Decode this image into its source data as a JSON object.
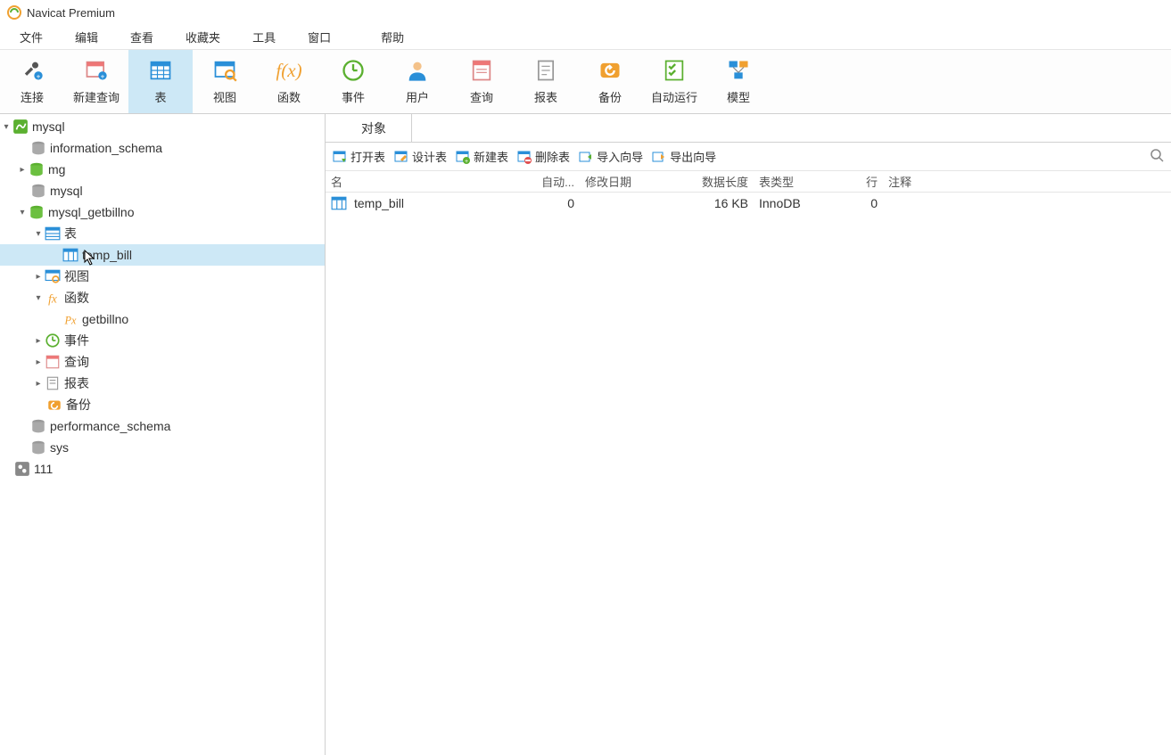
{
  "title": "Navicat Premium",
  "menu": [
    "文件",
    "编辑",
    "查看",
    "收藏夹",
    "工具",
    "窗口",
    "帮助"
  ],
  "toolbar": [
    {
      "id": "connect",
      "label": "连接"
    },
    {
      "id": "newquery",
      "label": "新建查询"
    },
    {
      "id": "table",
      "label": "表",
      "active": true
    },
    {
      "id": "view",
      "label": "视图"
    },
    {
      "id": "function",
      "label": "函数"
    },
    {
      "id": "event",
      "label": "事件"
    },
    {
      "id": "user",
      "label": "用户"
    },
    {
      "id": "query",
      "label": "查询"
    },
    {
      "id": "report",
      "label": "报表"
    },
    {
      "id": "backup",
      "label": "备份"
    },
    {
      "id": "autorun",
      "label": "自动运行"
    },
    {
      "id": "model",
      "label": "模型"
    }
  ],
  "tree": {
    "conn": "mysql",
    "dbs": {
      "info": "information_schema",
      "mg": "mg",
      "mysql": "mysql",
      "getbillno": "mysql_getbillno",
      "perf": "performance_schema",
      "sys": "sys"
    },
    "folders": {
      "tables": "表",
      "views": "视图",
      "functions": "函数",
      "events": "事件",
      "queries": "查询",
      "reports": "报表",
      "backups": "备份"
    },
    "items": {
      "temp_bill": "temp_bill",
      "getbillno": "getbillno"
    },
    "other": "111"
  },
  "tab": {
    "objects": "对象"
  },
  "objbar": {
    "open": "打开表",
    "design": "设计表",
    "new": "新建表",
    "delete": "删除表",
    "import": "导入向导",
    "export": "导出向导"
  },
  "cols": {
    "name": "名",
    "auto": "自动...",
    "mod": "修改日期",
    "size": "数据长度",
    "type": "表类型",
    "rows": "行",
    "comm": "注释"
  },
  "rows": [
    {
      "name": "temp_bill",
      "auto": "0",
      "mod": "",
      "size": "16 KB",
      "type": "InnoDB",
      "rows": "0",
      "comm": ""
    }
  ]
}
